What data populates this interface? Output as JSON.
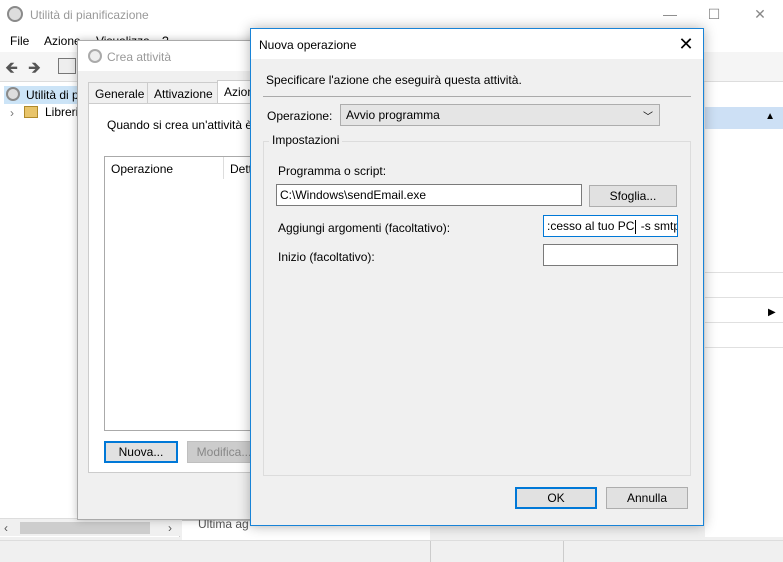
{
  "main_window": {
    "title": "Utilità di pianificazione",
    "controls": {
      "minimize": "—",
      "maximize": "☐",
      "close": "✕"
    },
    "menu": [
      "File",
      "Azione",
      "Visualizza",
      "?"
    ],
    "tree": {
      "root_label": "Utilità di p",
      "child_label": "Librerie"
    },
    "right_pane_fragment": "Ultima ag"
  },
  "crea_attivita": {
    "title": "Crea attività",
    "tabs": [
      "Generale",
      "Attivazione",
      "Azioni"
    ],
    "description": "Quando si crea un'attività è",
    "columns": [
      "Operazione",
      "Dettagli"
    ],
    "buttons": {
      "new": "Nuova...",
      "edit": "Modifica..."
    }
  },
  "dialog": {
    "title": "Nuova operazione",
    "close": "✕",
    "instruction": "Specificare l'azione che eseguirà questa attività.",
    "operation_label": "Operazione:",
    "operation_value": "Avvio programma",
    "settings_label": "Impostazioni",
    "program_label": "Programma o script:",
    "program_value": "C:\\Windows\\sendEmail.exe",
    "browse_button": "Sfoglia...",
    "args_label": "Aggiungi argomenti (facoltativo):",
    "args_value_before": ":cesso al tuo PC",
    "args_value_after": " -s smtp.",
    "start_label": "Inizio (facoltativo):",
    "start_value": "",
    "ok_button": "OK",
    "cancel_button": "Annulla"
  }
}
